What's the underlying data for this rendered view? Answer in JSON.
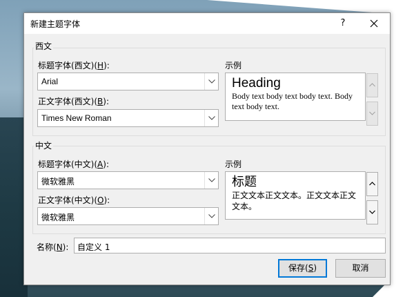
{
  "dialog": {
    "title": "新建主题字体",
    "help_label": "?",
    "close_icon": "close-icon"
  },
  "western": {
    "group_label": "西文",
    "heading_font": {
      "label_prefix": "标题字体(西文)(",
      "accel": "H",
      "label_suffix": "):",
      "value": "Arial"
    },
    "body_font": {
      "label_prefix": "正文字体(西文)(",
      "accel": "B",
      "label_suffix": "):",
      "value": "Times New Roman"
    },
    "sample": {
      "label": "示例",
      "heading": "Heading",
      "body": "Body text body text body text. Body text body text."
    }
  },
  "eastasian": {
    "group_label": "中文",
    "heading_font": {
      "label_prefix": "标题字体(中文)(",
      "accel": "A",
      "label_suffix": "):",
      "value": "微软雅黑"
    },
    "body_font": {
      "label_prefix": "正文字体(中文)(",
      "accel": "O",
      "label_suffix": "):",
      "value": "微软雅黑"
    },
    "sample": {
      "label": "示例",
      "heading": "标题",
      "body": "正文文本正文文本。正文文本正文文本。"
    }
  },
  "name": {
    "label_prefix": "名称(",
    "accel": "N",
    "label_suffix": "):",
    "value": "自定义 1"
  },
  "buttons": {
    "save_prefix": "保存(",
    "save_accel": "S",
    "save_suffix": ")",
    "cancel": "取消"
  },
  "colors": {
    "default_button_border": "#0078d7",
    "dialog_bg": "#f0f0f0"
  }
}
